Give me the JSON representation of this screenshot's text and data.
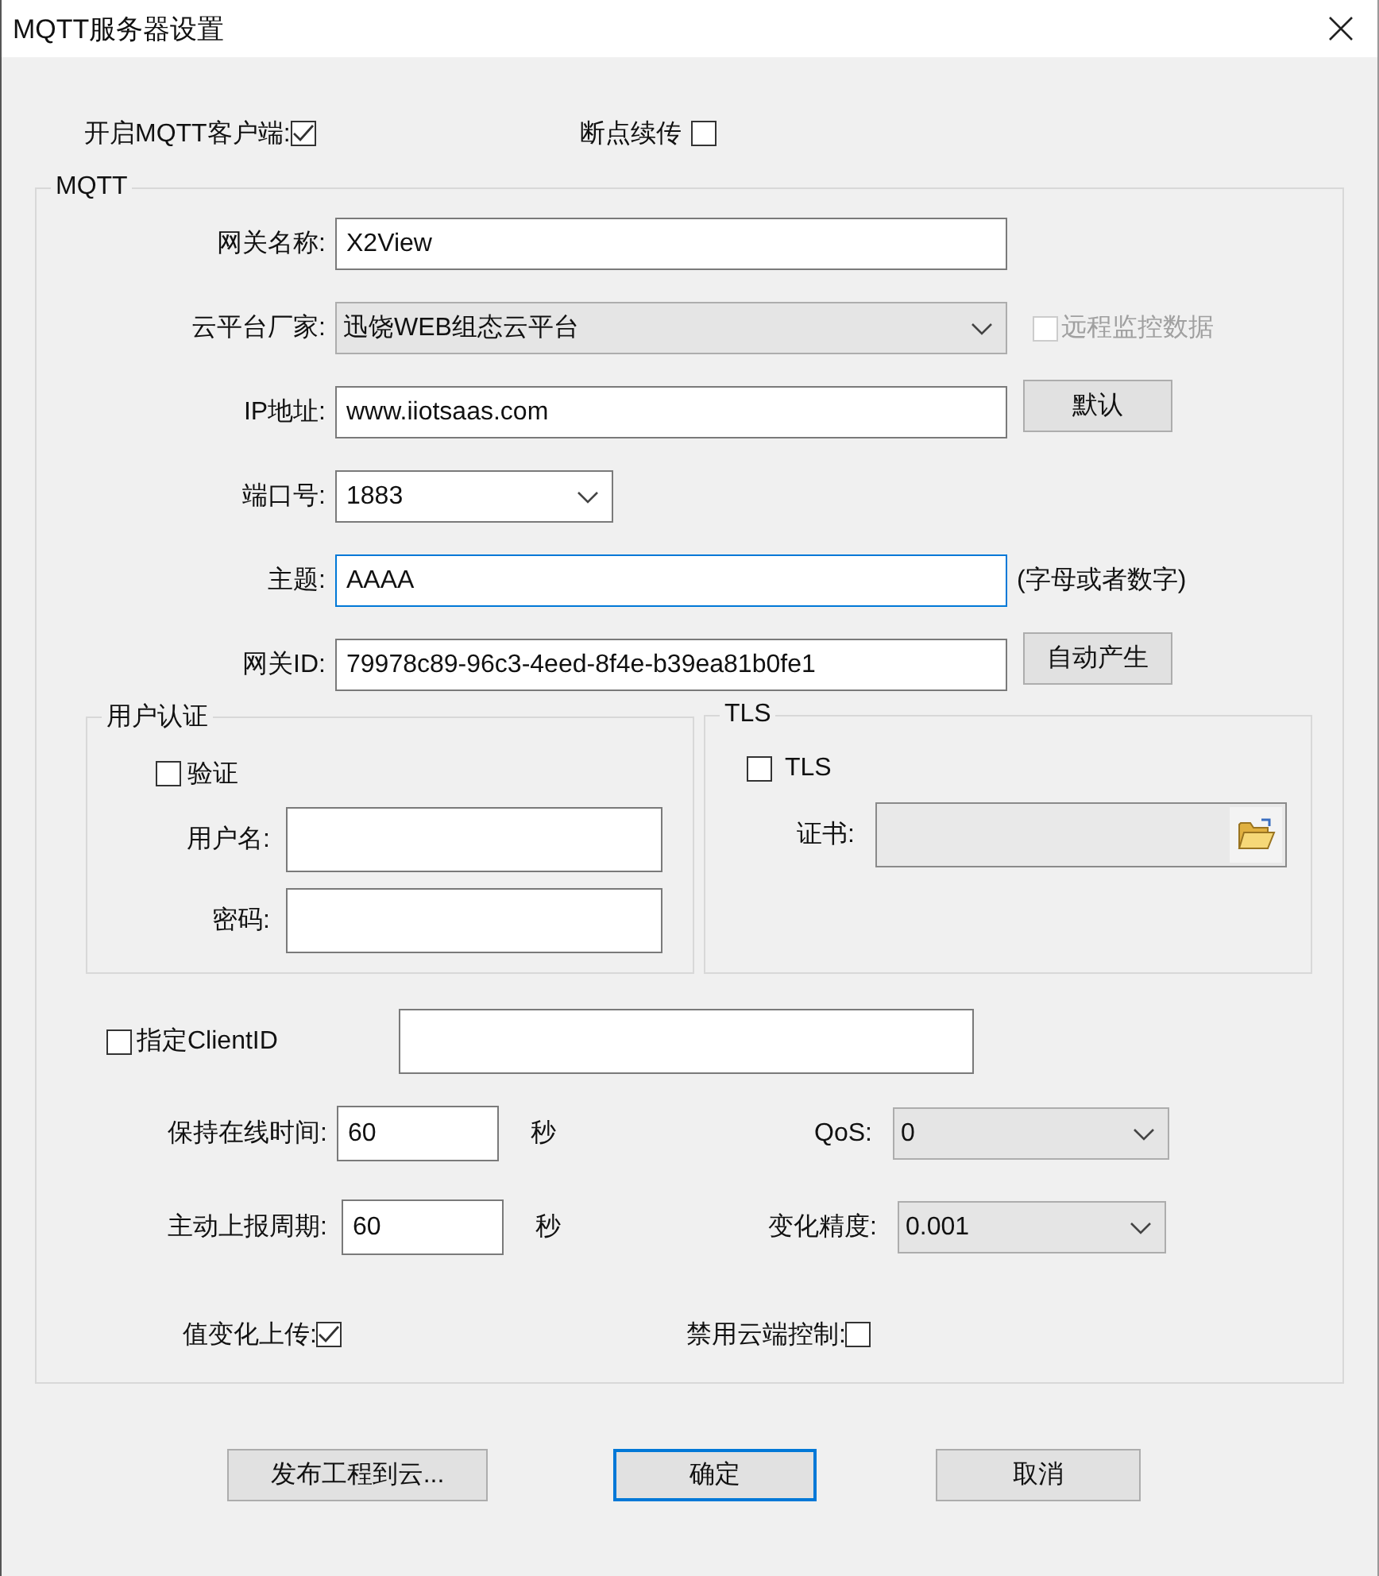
{
  "window": {
    "title": "MQTT服务器设置"
  },
  "top_options": [
    {
      "label": "开启MQTT客户端:",
      "checked": true
    },
    {
      "label": "断点续传",
      "checked": false
    }
  ],
  "mqtt_group": {
    "title": "MQTT",
    "fields": [
      {
        "kind": "text",
        "label": "网关名称:",
        "value": "X2View",
        "focused": false
      },
      {
        "kind": "combo",
        "label": "云平台厂家:",
        "value": "迅饶WEB组态云平台",
        "editable": false,
        "side": {
          "kind": "checkbox",
          "label": "远程监控数据",
          "checked": false,
          "disabled": true
        }
      },
      {
        "kind": "text",
        "label": "IP地址:",
        "value": "www.iiotsaas.com",
        "focused": false,
        "side": {
          "kind": "button",
          "label": "默认"
        }
      },
      {
        "kind": "combo",
        "label": "端口号:",
        "value": "1883",
        "editable": true
      },
      {
        "kind": "text",
        "label": "主题:",
        "value": "AAAA",
        "focused": true,
        "side": {
          "kind": "hint",
          "text": "(字母或者数字)"
        }
      },
      {
        "kind": "text",
        "label": "网关ID:",
        "value": "79978c89-96c3-4eed-8f4e-b39ea81b0fe1",
        "focused": false,
        "side": {
          "kind": "button",
          "label": "自动产生"
        }
      }
    ],
    "auth_group": {
      "title": "用户认证",
      "verify": {
        "label": "验证",
        "checked": false
      },
      "fields": [
        {
          "label": "用户名:"
        },
        {
          "label": "密码:"
        }
      ]
    },
    "tls_group": {
      "title": "TLS",
      "tls": {
        "label": "TLS",
        "checked": false
      },
      "certificate": {
        "label": "证书:"
      }
    },
    "client_id": {
      "label": "指定ClientID",
      "checked": false
    },
    "rows": [
      {
        "left": {
          "label": "保持在线时间:",
          "value": "60",
          "unit": "秒"
        },
        "right": {
          "label": "QoS:",
          "value": "0",
          "editable": false
        }
      },
      {
        "left": {
          "label": "主动上报周期:",
          "value": "60",
          "unit": "秒"
        },
        "right": {
          "label": "变化精度:",
          "value": "0.001",
          "editable": false
        }
      }
    ],
    "bottom_options": [
      {
        "label": "值变化上传:",
        "checked": true
      },
      {
        "label": "禁用云端控制:",
        "checked": false
      }
    ]
  },
  "buttons": [
    {
      "label": "发布工程到云...",
      "default": false
    },
    {
      "label": "确定",
      "default": true
    },
    {
      "label": "取消",
      "default": false
    }
  ]
}
